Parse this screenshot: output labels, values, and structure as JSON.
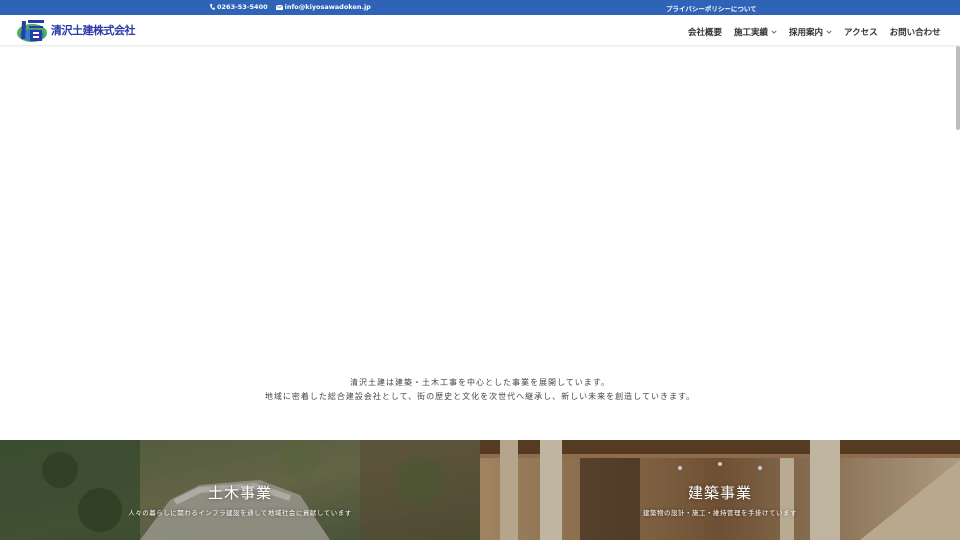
{
  "topbar": {
    "phone": "0263-53-5400",
    "email": "info@kiyosawadoken.jp",
    "privacy": "プライバシーポリシーについて",
    "bg_color": "#2e63b8"
  },
  "header": {
    "logo_text": "清沢土建株式会社",
    "logo_color": "#2a3aa8"
  },
  "nav": [
    {
      "label": "会社概要",
      "has_submenu": false
    },
    {
      "label": "施工実績",
      "has_submenu": true
    },
    {
      "label": "採用案内",
      "has_submenu": true
    },
    {
      "label": "アクセス",
      "has_submenu": false
    },
    {
      "label": "お問い合わせ",
      "has_submenu": false
    }
  ],
  "intro": {
    "line1": "清沢土建は建築・土木工事を中心とした事業を展開しています。",
    "line2": "地域に密着した総合建設会社として、街の歴史と文化を次世代へ継承し、新しい未来を創造していきます。"
  },
  "tiles": {
    "civil": {
      "title": "土木事業",
      "desc": "人々の暮らしに関わるインフラ建設を通して地域社会に貢献しています"
    },
    "architecture": {
      "title": "建築事業",
      "desc": "建築物の設計・施工・維持管理を手掛けています"
    }
  }
}
